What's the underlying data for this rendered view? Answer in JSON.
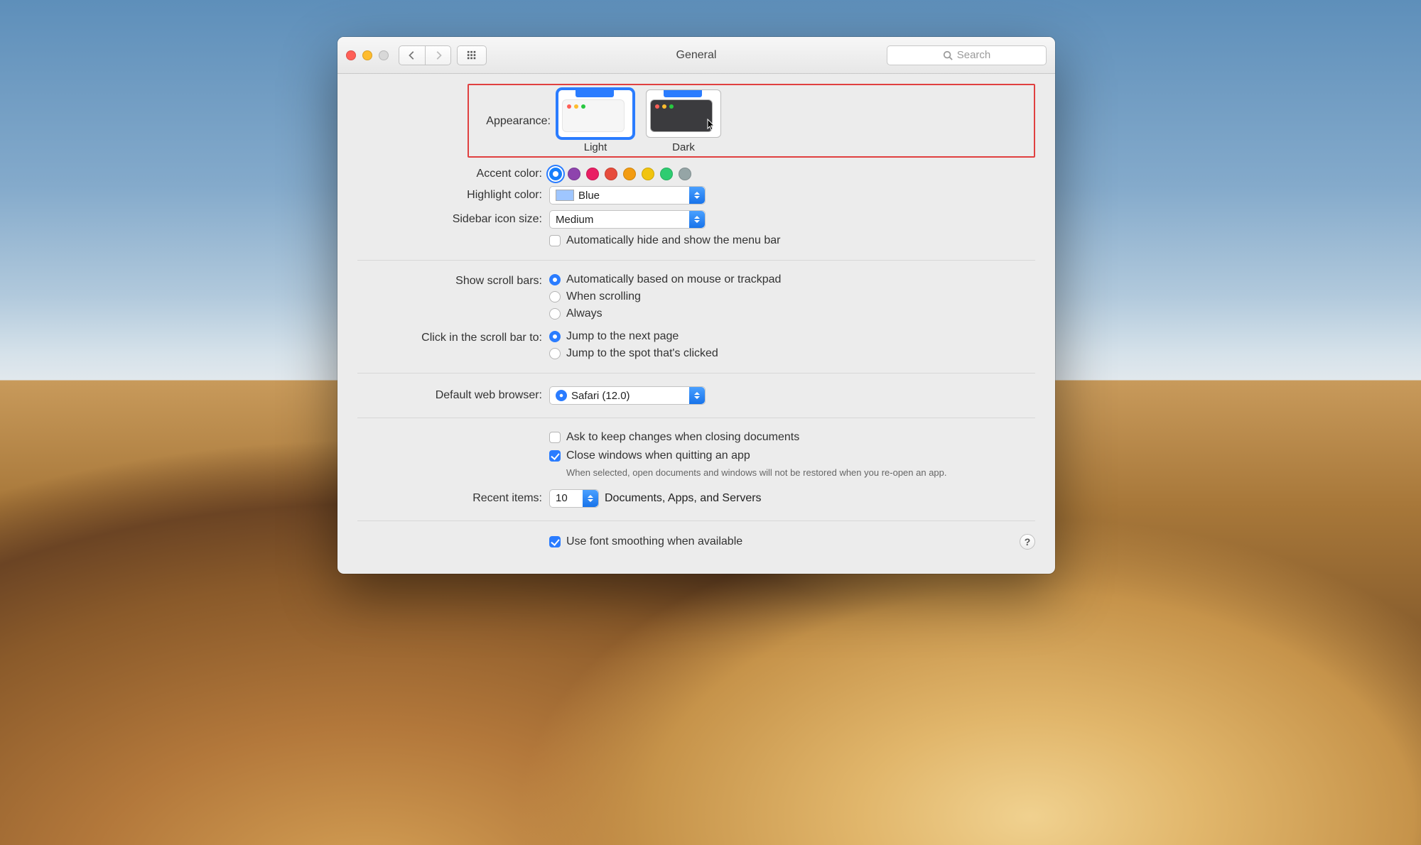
{
  "window": {
    "title": "General",
    "search_placeholder": "Search"
  },
  "appearance": {
    "label": "Appearance:",
    "options": {
      "light": "Light",
      "dark": "Dark"
    },
    "selected": "light"
  },
  "accent": {
    "label": "Accent color:",
    "colors": [
      "#157efb",
      "#8e44ad",
      "#e91e63",
      "#e74c3c",
      "#f39c12",
      "#f1c40f",
      "#2ecc71",
      "#95a5a6"
    ],
    "selected_index": 0
  },
  "highlight": {
    "label": "Highlight color:",
    "value": "Blue"
  },
  "sidebar": {
    "label": "Sidebar icon size:",
    "value": "Medium"
  },
  "menubar_autohide": {
    "label": "Automatically hide and show the menu bar",
    "checked": false
  },
  "scrollbars": {
    "label": "Show scroll bars:",
    "options": {
      "auto": "Automatically based on mouse or trackpad",
      "scrolling": "When scrolling",
      "always": "Always"
    },
    "selected": "auto"
  },
  "scrollclick": {
    "label": "Click in the scroll bar to:",
    "options": {
      "next": "Jump to the next page",
      "spot": "Jump to the spot that's clicked"
    },
    "selected": "next"
  },
  "browser": {
    "label": "Default web browser:",
    "value": "Safari (12.0)"
  },
  "documents": {
    "ask_keep": {
      "label": "Ask to keep changes when closing documents",
      "checked": false
    },
    "close_windows": {
      "label": "Close windows when quitting an app",
      "checked": true,
      "note": "When selected, open documents and windows will not be restored when you re-open an app."
    }
  },
  "recent": {
    "label": "Recent items:",
    "value": "10",
    "suffix": "Documents, Apps, and Servers"
  },
  "font_smoothing": {
    "label": "Use font smoothing when available",
    "checked": true
  },
  "help_symbol": "?"
}
